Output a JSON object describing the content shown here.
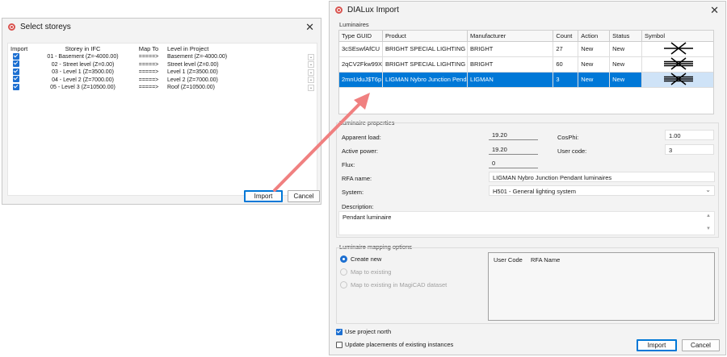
{
  "storeys": {
    "title": "Select storeys",
    "headers": [
      "Import",
      "Storey in IFC",
      "Map To",
      "Level in Project"
    ],
    "rows": [
      {
        "storey": "01 - Basement (Z=-4000.00)",
        "map": "=====>",
        "level": "Basement (Z=-4000.00)"
      },
      {
        "storey": "02 - Street level (Z=0.00)",
        "map": "=====>",
        "level": "Street level (Z=0.00)"
      },
      {
        "storey": "03 - Level 1 (Z=3500.00)",
        "map": "=====>",
        "level": "Level 1 (Z=3500.00)"
      },
      {
        "storey": "04 - Level 2 (Z=7000.00)",
        "map": "=====>",
        "level": "Level 2 (Z=7000.00)"
      },
      {
        "storey": "05 - Level 3 (Z=10500.00)",
        "map": "=====>",
        "level": "Roof (Z=10500.00)"
      }
    ],
    "import_label": "Import",
    "cancel_label": "Cancel",
    "close_glyph": "✕"
  },
  "dialux": {
    "title": "DIALux Import",
    "close_glyph": "✕",
    "luminaires_label": "Luminaires",
    "headers": [
      "Type GUID",
      "Product",
      "Manufacturer",
      "Count",
      "Action",
      "Status",
      "Symbol"
    ],
    "rows": [
      {
        "guid": "3cSEswfAfCU",
        "product": "BRIGHT SPECIAL LIGHTING S",
        "manufacturer": "BRIGHT",
        "count": "27",
        "action": "New",
        "status": "New"
      },
      {
        "guid": "2qCV2Fkw99X",
        "product": "BRIGHT SPECIAL LIGHTING S",
        "manufacturer": "BRIGHT",
        "count": "60",
        "action": "New",
        "status": "New"
      },
      {
        "guid": "2mnUduJ$T6p",
        "product": "LIGMAN Nybro Junction Pendan",
        "manufacturer": "LIGMAN",
        "count": "3",
        "action": "New",
        "status": "New"
      }
    ],
    "props_label": "Luminaire properties",
    "apparent_load_label": "Apparent load:",
    "apparent_load_value": "19.20",
    "active_power_label": "Active power:",
    "active_power_value": "19.20",
    "flux_label": "Flux:",
    "flux_value": "0",
    "cosphi_label": "CosPhi:",
    "cosphi_value": "1.00",
    "user_code_label": "User code:",
    "user_code_value": "3",
    "rfa_name_label": "RFA name:",
    "rfa_name_value": "LIGMAN Nybro Junction Pendant luminaires",
    "system_label": "System:",
    "system_value": "H501 - General lighting system",
    "description_label": "Description:",
    "description_value": "Pendant luminaire",
    "mapping_label": "Luminaire mapping options",
    "opt_create": "Create new",
    "opt_map": "Map to existing",
    "opt_map_magicad": "Map to existing in MagiCAD dataset",
    "map_headers": [
      "User Code",
      "RFA Name"
    ],
    "use_north_label": "Use project north",
    "update_label": "Update placements of existing instances",
    "import_label": "Import",
    "cancel_label": "Cancel"
  },
  "colors": {
    "selection": "#0078d7",
    "arrow": "#f08080",
    "checkbox": "#1c6fd1"
  }
}
